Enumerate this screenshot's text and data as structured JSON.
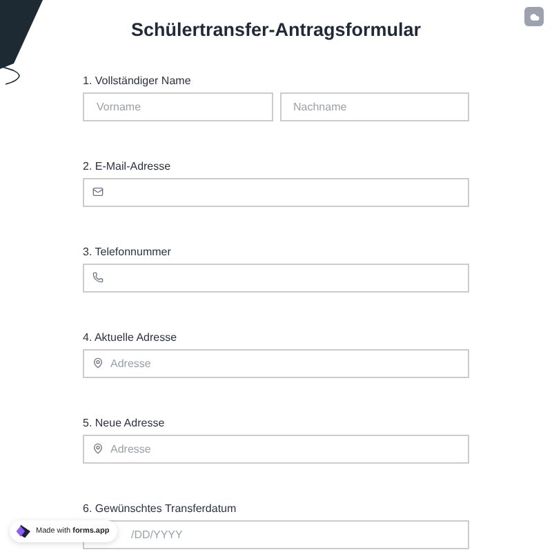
{
  "title": "Schülertransfer-Antragsformular",
  "questions": [
    {
      "label": "1. Vollständiger Name",
      "kind": "name",
      "fields": [
        {
          "placeholder": "Vorname"
        },
        {
          "placeholder": "Nachname"
        }
      ]
    },
    {
      "label": "2. E-Mail-Adresse",
      "kind": "email"
    },
    {
      "label": "3. Telefonnummer",
      "kind": "phone"
    },
    {
      "label": "4. Aktuelle Adresse",
      "kind": "address",
      "fields": [
        {
          "placeholder": "Adresse"
        }
      ]
    },
    {
      "label": "5. Neue Adresse",
      "kind": "address",
      "fields": [
        {
          "placeholder": "Adresse"
        }
      ]
    },
    {
      "label": "6. Gewünschtes Transferdatum",
      "kind": "date",
      "fields": [
        {
          "placeholder": "/DD/YYYY"
        }
      ]
    }
  ],
  "badge": "Made with **forms.app**"
}
